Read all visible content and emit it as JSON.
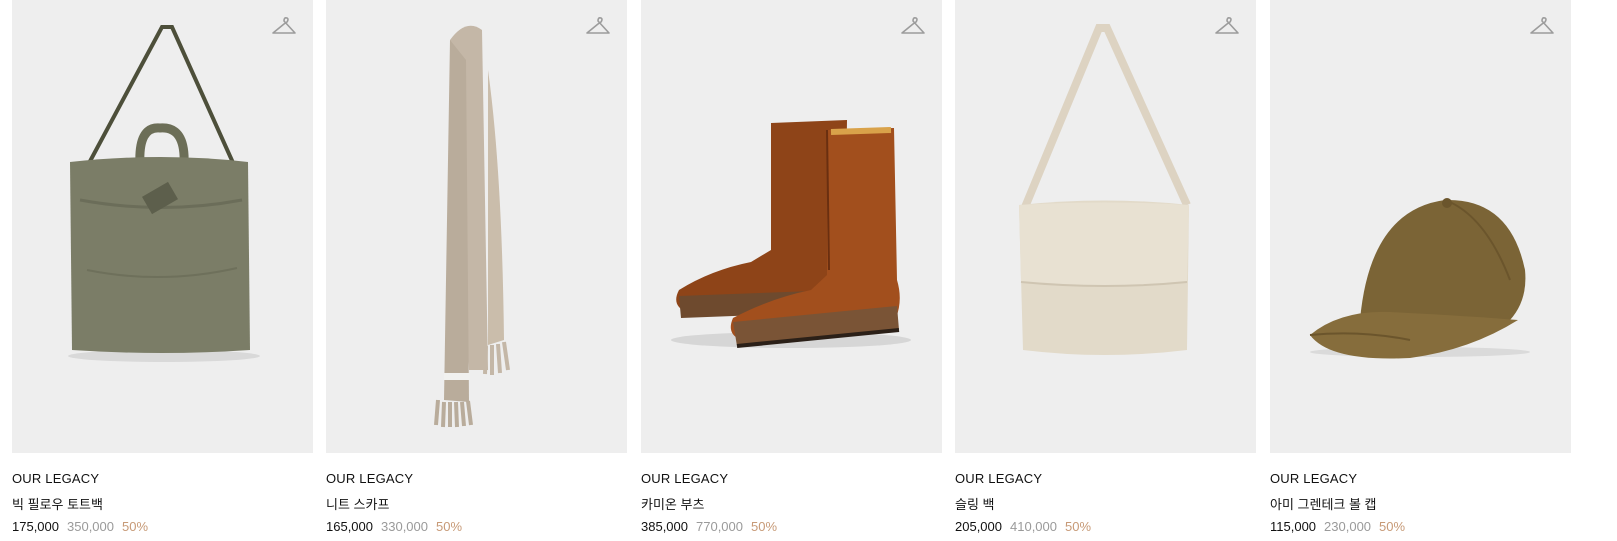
{
  "products": [
    {
      "brand": "OUR LEGACY",
      "name": "빅 필로우 토트백",
      "sale_price": "175,000",
      "original_price": "350,000",
      "discount": "50%",
      "image": "tote-bag"
    },
    {
      "brand": "OUR LEGACY",
      "name": "니트 스카프",
      "sale_price": "165,000",
      "original_price": "330,000",
      "discount": "50%",
      "image": "scarf"
    },
    {
      "brand": "OUR LEGACY",
      "name": "카미온 부츠",
      "sale_price": "385,000",
      "original_price": "770,000",
      "discount": "50%",
      "image": "boots"
    },
    {
      "brand": "OUR LEGACY",
      "name": "슬링 백",
      "sale_price": "205,000",
      "original_price": "410,000",
      "discount": "50%",
      "image": "sling-bag"
    },
    {
      "brand": "OUR LEGACY",
      "name": "아미 그렌테크 볼 캡",
      "sale_price": "115,000",
      "original_price": "230,000",
      "discount": "50%",
      "image": "ball-cap"
    }
  ],
  "icons": {
    "wishlist": "hanger-icon"
  },
  "colors": {
    "image_background": "#eeeeee",
    "original_price": "#9a9a9a",
    "discount": "#c79a77"
  }
}
